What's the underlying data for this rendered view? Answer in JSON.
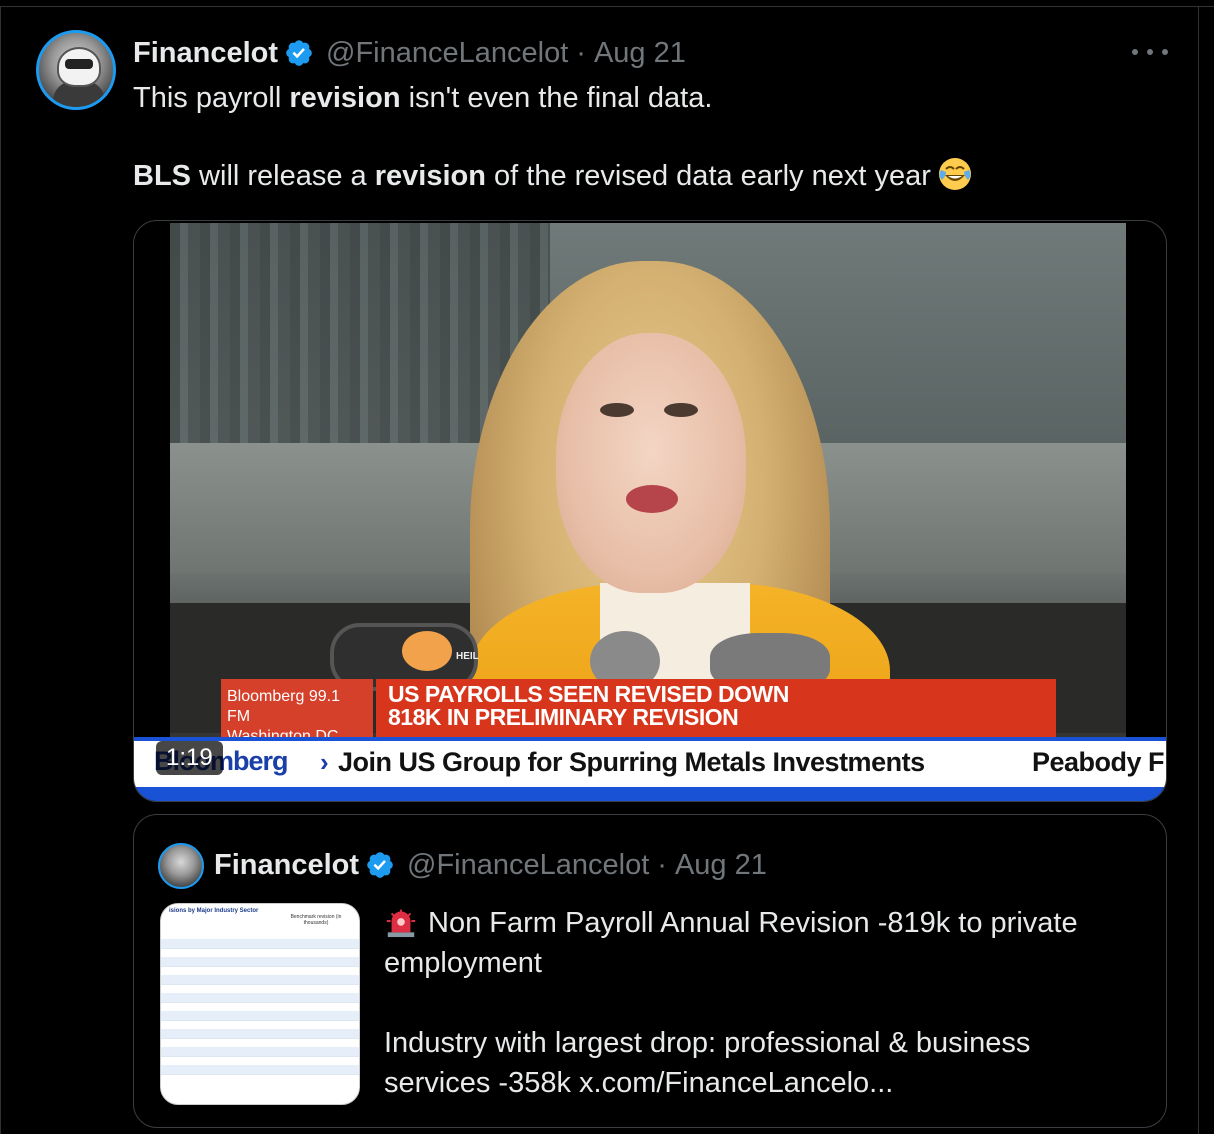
{
  "tweet": {
    "author_name": "Financelot",
    "handle": "@FinanceLancelot",
    "separator": "·",
    "date": "Aug 21",
    "text_line1_pre": "This payroll ",
    "text_line1_bold": "revision",
    "text_line1_post": " isn't even the final data.",
    "text_line2_bold1": "BLS",
    "text_line2_mid": " will release a ",
    "text_line2_bold2": "revision",
    "text_line2_post": " of the revised data early next year",
    "emoji": "face-with-tears-of-joy-icon"
  },
  "video": {
    "duration": "1:19",
    "lower_third_left_line1": "Bloomberg 99.1 FM",
    "lower_third_left_line2": "Washington DC",
    "headline_line1": "US PAYROLLS SEEN REVISED DOWN",
    "headline_line2": "818K IN PRELIMINARY REVISION",
    "ticker_brand": "Bloomberg",
    "ticker_arrow": "›",
    "ticker_text": "Join US Group for Spurring Metals Investments",
    "ticker_text2": "Peabody F",
    "mic_label": "HEIL"
  },
  "quoted_tweet": {
    "author_name": "Financelot",
    "handle": "@FinanceLancelot",
    "separator": "·",
    "date": "Aug 21",
    "text_line1": "Non Farm Payroll Annual Revision -819k to private",
    "text_line2": "employment",
    "text_line3": "Industry with largest drop: professional & business",
    "text_line4": "services -358k  x.com/FinanceLancelo...",
    "thumb_title": "isions by Major Industry Sector",
    "thumb_colhead": "Benchmark revision (in thousands)"
  },
  "colors": {
    "background": "#000000",
    "text": "#e7e9ea",
    "muted": "#71767b",
    "verified": "#1d9bf0",
    "bloomberg_red": "#d7361c",
    "ticker_blue": "#1a52d6"
  }
}
